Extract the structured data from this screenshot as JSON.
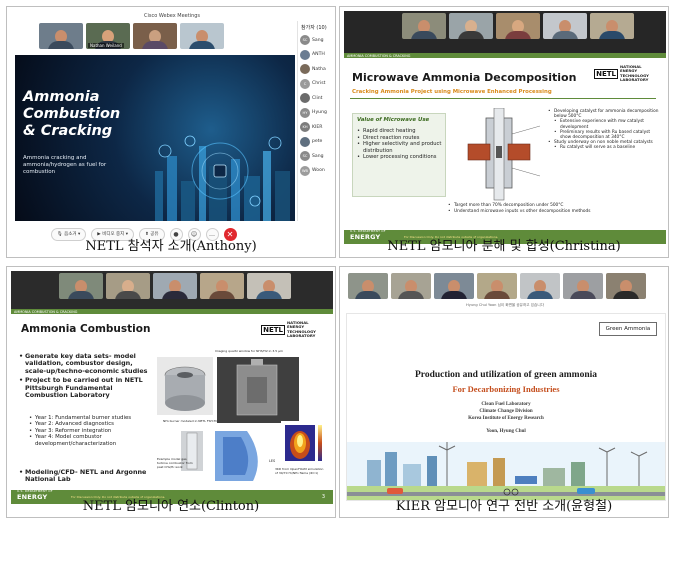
{
  "captions": {
    "a": "NETL 참석자 소개(Anthony)",
    "b": "NETL 암모니아 분해 및 합성(Christina)",
    "c": "NETL 암모니아 연소(Clinton)",
    "d": "KIER 암모니아 연구 전반 소개(윤형철)"
  },
  "panel_a": {
    "window_title": "Cisco Webex Meetings",
    "thumb_names": [
      "",
      "Nathan Weiland",
      "",
      ""
    ],
    "slide_headline": [
      "Ammonia",
      "Combustion",
      "& Cracking"
    ],
    "slide_subtitle": "Ammonia cracking and ammonia/hydrogen as fuel for combustion",
    "participants_title": "참가자 (10)",
    "participants": [
      {
        "initials": "SC",
        "name": "Sang",
        "color": "#8a8a8a"
      },
      {
        "initials": "",
        "name": "ANTH",
        "color": "#6a7c92"
      },
      {
        "initials": "",
        "name": "Natha",
        "color": "#7a6a5a"
      },
      {
        "initials": "C",
        "name": "Christ",
        "color": "#9a9a9a"
      },
      {
        "initials": "",
        "name": "Clint",
        "color": "#6b6b6b"
      },
      {
        "initials": "HY",
        "name": "Hyung",
        "color": "#8c8c8c"
      },
      {
        "initials": "KH",
        "name": "KIER",
        "color": "#7c7c7c"
      },
      {
        "initials": "",
        "name": "pete",
        "color": "#5f6f7f"
      },
      {
        "initials": "SC",
        "name": "Sang",
        "color": "#8a8a8a"
      },
      {
        "initials": "WB",
        "name": "Woon",
        "color": "#9c9c9c"
      }
    ],
    "toolbar": {
      "mute": "음소거",
      "video": "비디오 중지",
      "share": "공유"
    }
  },
  "panel_b": {
    "tag": "AMMONIA COMBUSTION & CRACKING",
    "title": "Microwave Ammonia Decomposition",
    "subtitle": "Cracking Ammonia Project using Microwave Enhanced Processing",
    "box_title": "Value of Microwave Use",
    "box_items": [
      "Rapid direct heating",
      "Direct reaction routes",
      "Higher selectivity and product distribution",
      "Lower processing conditions"
    ],
    "bullets": [
      "Developing catalyst for ammonia decomposition below 500°C",
      "Extensive experience with mw catalyst development",
      "Preliminary results with Ru based catalyst show decomposition at 340°C",
      "Study underway on non noble metal catalysts",
      "Ru catalyst will serve as a baseline",
      "Target more than 70% decomposition under 500°C",
      "Understand microwave inputs vs other decomposition methods"
    ],
    "netl": {
      "short": "NETL",
      "long": "NATIONAL ENERGY TECHNOLOGY LABORATORY"
    },
    "energy": "ENERGY",
    "energy_dept": "U.S. DEPARTMENT OF",
    "footnote": "For Discussion Only. Do not distribute outside of organizations."
  },
  "panel_c": {
    "tag": "AMMONIA COMBUSTION & CRACKING",
    "title": "Ammonia Combustion",
    "bullets": [
      "Generate key data sets- model validation, combustor design, scale-up/techno-economic studies",
      "Project to be carried out in NETL Pittsburgh Fundamental Combustion Laboratory",
      "Modeling/CFD- NETL and Argonne National Lab"
    ],
    "sub_bullets": [
      "Year 1: Fundamental burner studies",
      "Year 2: Advanced diagnostics",
      "Year 3: Reformer integration",
      "Year 4: Model combustor development/characterization"
    ],
    "figure_labels": {
      "imaging": "Imaging quartz window for NH3/H2 in 3.5 μm",
      "burner": "NH₃ burner modeled in NETL FSH-TCL",
      "example": "Example model gas turbine combustor from past CH₄/H₂ work",
      "les": "LES",
      "sim": "3KD from OpenFOAM simulation of 30/70 H₂/NH₃ flame (Φ=1)"
    },
    "netl": {
      "short": "NETL",
      "long": "NATIONAL ENERGY TECHNOLOGY LABORATORY"
    },
    "energy": "ENERGY",
    "energy_dept": "U.S. DEPARTMENT OF",
    "footnote": "For Discussion Only. Do not distribute outside of organizations.",
    "page": "3"
  },
  "panel_d": {
    "presenter_bar": "Hyung Chul Yoon 님이 화면을 공유하고 있습니다",
    "badge": "Green Ammonia",
    "title": "Production and utilization of green ammonia",
    "subtitle": "For Decarbonizing Industries",
    "lab": "Clean Fuel Laboratory",
    "division": "Climate Change Division",
    "institute": "Korea Institute of Energy Research",
    "author": "Yoon, Hyung Chul"
  },
  "colors": {
    "netl_green": "#5f8b3a",
    "title_blue": "#1f4e8c",
    "end_call_red": "#e0282e"
  }
}
